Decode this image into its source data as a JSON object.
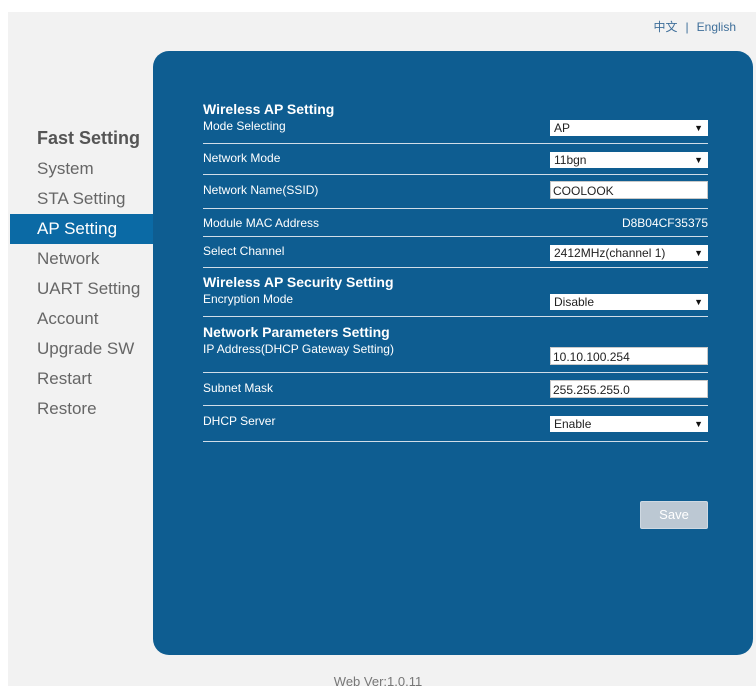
{
  "header": {
    "lang_cn": "中文",
    "separator": "|",
    "lang_en": "English"
  },
  "sidebar": {
    "items": [
      {
        "label": "Fast Setting"
      },
      {
        "label": "System"
      },
      {
        "label": "STA Setting"
      },
      {
        "label": "AP Setting"
      },
      {
        "label": "Network"
      },
      {
        "label": "UART Setting"
      },
      {
        "label": "Account"
      },
      {
        "label": "Upgrade SW"
      },
      {
        "label": "Restart"
      },
      {
        "label": "Restore"
      }
    ],
    "active": "AP Setting"
  },
  "wireless_ap": {
    "title": "Wireless AP Setting",
    "mode_label": "Mode Selecting",
    "mode_value": "AP",
    "network_mode_label": "Network Mode",
    "network_mode_value": "11bgn",
    "ssid_label": "Network Name(SSID)",
    "ssid_value": "COOLOOK",
    "mac_label": "Module MAC Address",
    "mac_value": "D8B04CF35375",
    "channel_label": "Select Channel",
    "channel_value": "2412MHz(channel 1)"
  },
  "security": {
    "title": "Wireless AP Security Setting",
    "encryption_label": "Encryption Mode",
    "encryption_value": "Disable"
  },
  "network_params": {
    "title": "Network Parameters Setting",
    "ip_label": "IP Address(DHCP Gateway Setting)",
    "ip_value": "10.10.100.254",
    "subnet_label": "Subnet Mask",
    "subnet_value": "255.255.255.0",
    "dhcp_label": "DHCP Server",
    "dhcp_value": "Enable"
  },
  "actions": {
    "save_label": "Save"
  },
  "footer": {
    "version": "Web Ver:1.0.11"
  },
  "colors": {
    "panel": "#0e5d91",
    "active_item": "#0b6aa5",
    "save_button": "#bcc8d3"
  }
}
